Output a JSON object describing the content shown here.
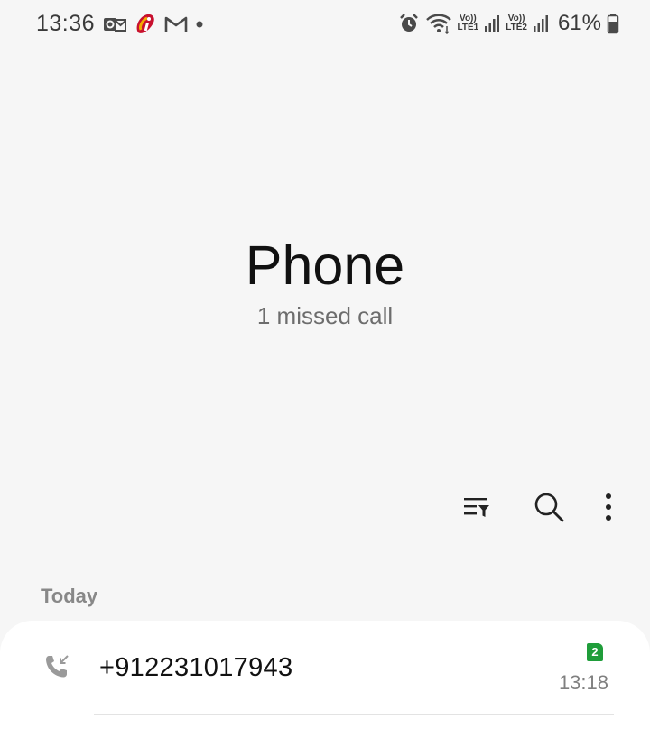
{
  "status_bar": {
    "time": "13:36",
    "battery_percent": "61%",
    "sim1_label": "LTE1",
    "sim2_label": "LTE2",
    "volte_label": "Vo))"
  },
  "header": {
    "title": "Phone",
    "subtitle": "1 missed call"
  },
  "toolbar": {
    "icons": [
      "filter-icon",
      "search-icon",
      "more-options-icon"
    ]
  },
  "call_log": {
    "section_label": "Today",
    "entries": [
      {
        "number": "+912231017943",
        "sim": "2",
        "time": "13:18",
        "type_icon": "incoming-call-icon"
      }
    ]
  },
  "colors": {
    "background": "#f6f6f6",
    "card": "#ffffff",
    "sim_badge": "#1f9d3a"
  }
}
